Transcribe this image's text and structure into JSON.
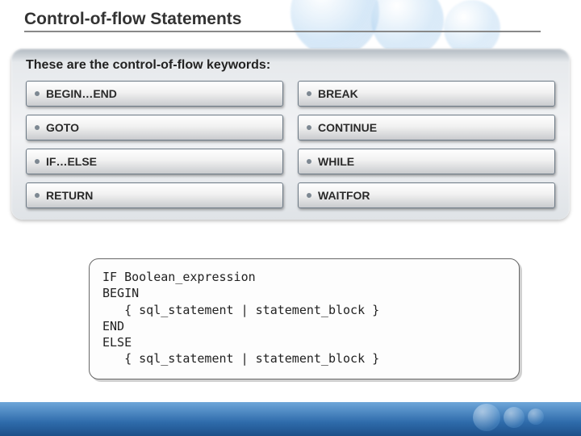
{
  "title": "Control-of-flow Statements",
  "panel": {
    "heading": "These are the control-of-flow keywords:",
    "items": [
      {
        "label": "BEGIN…END"
      },
      {
        "label": "BREAK"
      },
      {
        "label": "GOTO"
      },
      {
        "label": "CONTINUE"
      },
      {
        "label": "IF…ELSE"
      },
      {
        "label": "WHILE"
      },
      {
        "label": "RETURN"
      },
      {
        "label": "WAITFOR"
      }
    ]
  },
  "code": "IF Boolean_expression\nBEGIN\n   { sql_statement | statement_block }\nEND\nELSE\n   { sql_statement | statement_block }"
}
